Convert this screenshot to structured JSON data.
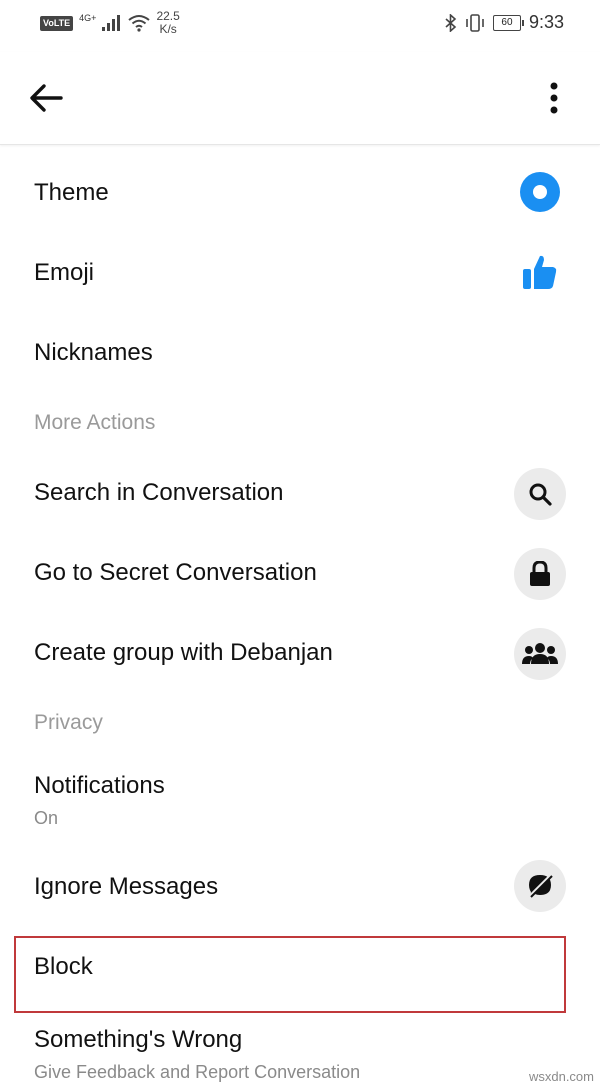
{
  "status_bar": {
    "volte": "VoLTE",
    "network": "4G+",
    "speed_value": "22.5",
    "speed_unit": "K/s",
    "battery": "60",
    "time": "9:33"
  },
  "app_bar": {
    "back_icon": "arrow-left-icon",
    "more_icon": "more-vertical-icon"
  },
  "items": {
    "theme": {
      "label": "Theme",
      "icon": "theme-circle-icon",
      "color": "#1a8ff2"
    },
    "emoji": {
      "label": "Emoji",
      "icon": "thumbs-up-icon",
      "color": "#1a8ff2"
    },
    "nicknames": {
      "label": "Nicknames"
    },
    "search": {
      "label": "Search in Conversation",
      "icon": "search-icon"
    },
    "secret": {
      "label": "Go to Secret Conversation",
      "icon": "lock-icon"
    },
    "group": {
      "label": "Create group with Debanjan",
      "icon": "group-icon"
    },
    "notifications": {
      "label": "Notifications",
      "sub": "On"
    },
    "ignore": {
      "label": "Ignore Messages",
      "icon": "ignore-icon"
    },
    "block": {
      "label": "Block"
    },
    "wrong": {
      "label": "Something's Wrong",
      "sub": "Give Feedback and Report Conversation"
    }
  },
  "sections": {
    "more_actions": "More Actions",
    "privacy": "Privacy"
  },
  "highlight_color": "#c0393b",
  "watermark": "wsxdn.com"
}
